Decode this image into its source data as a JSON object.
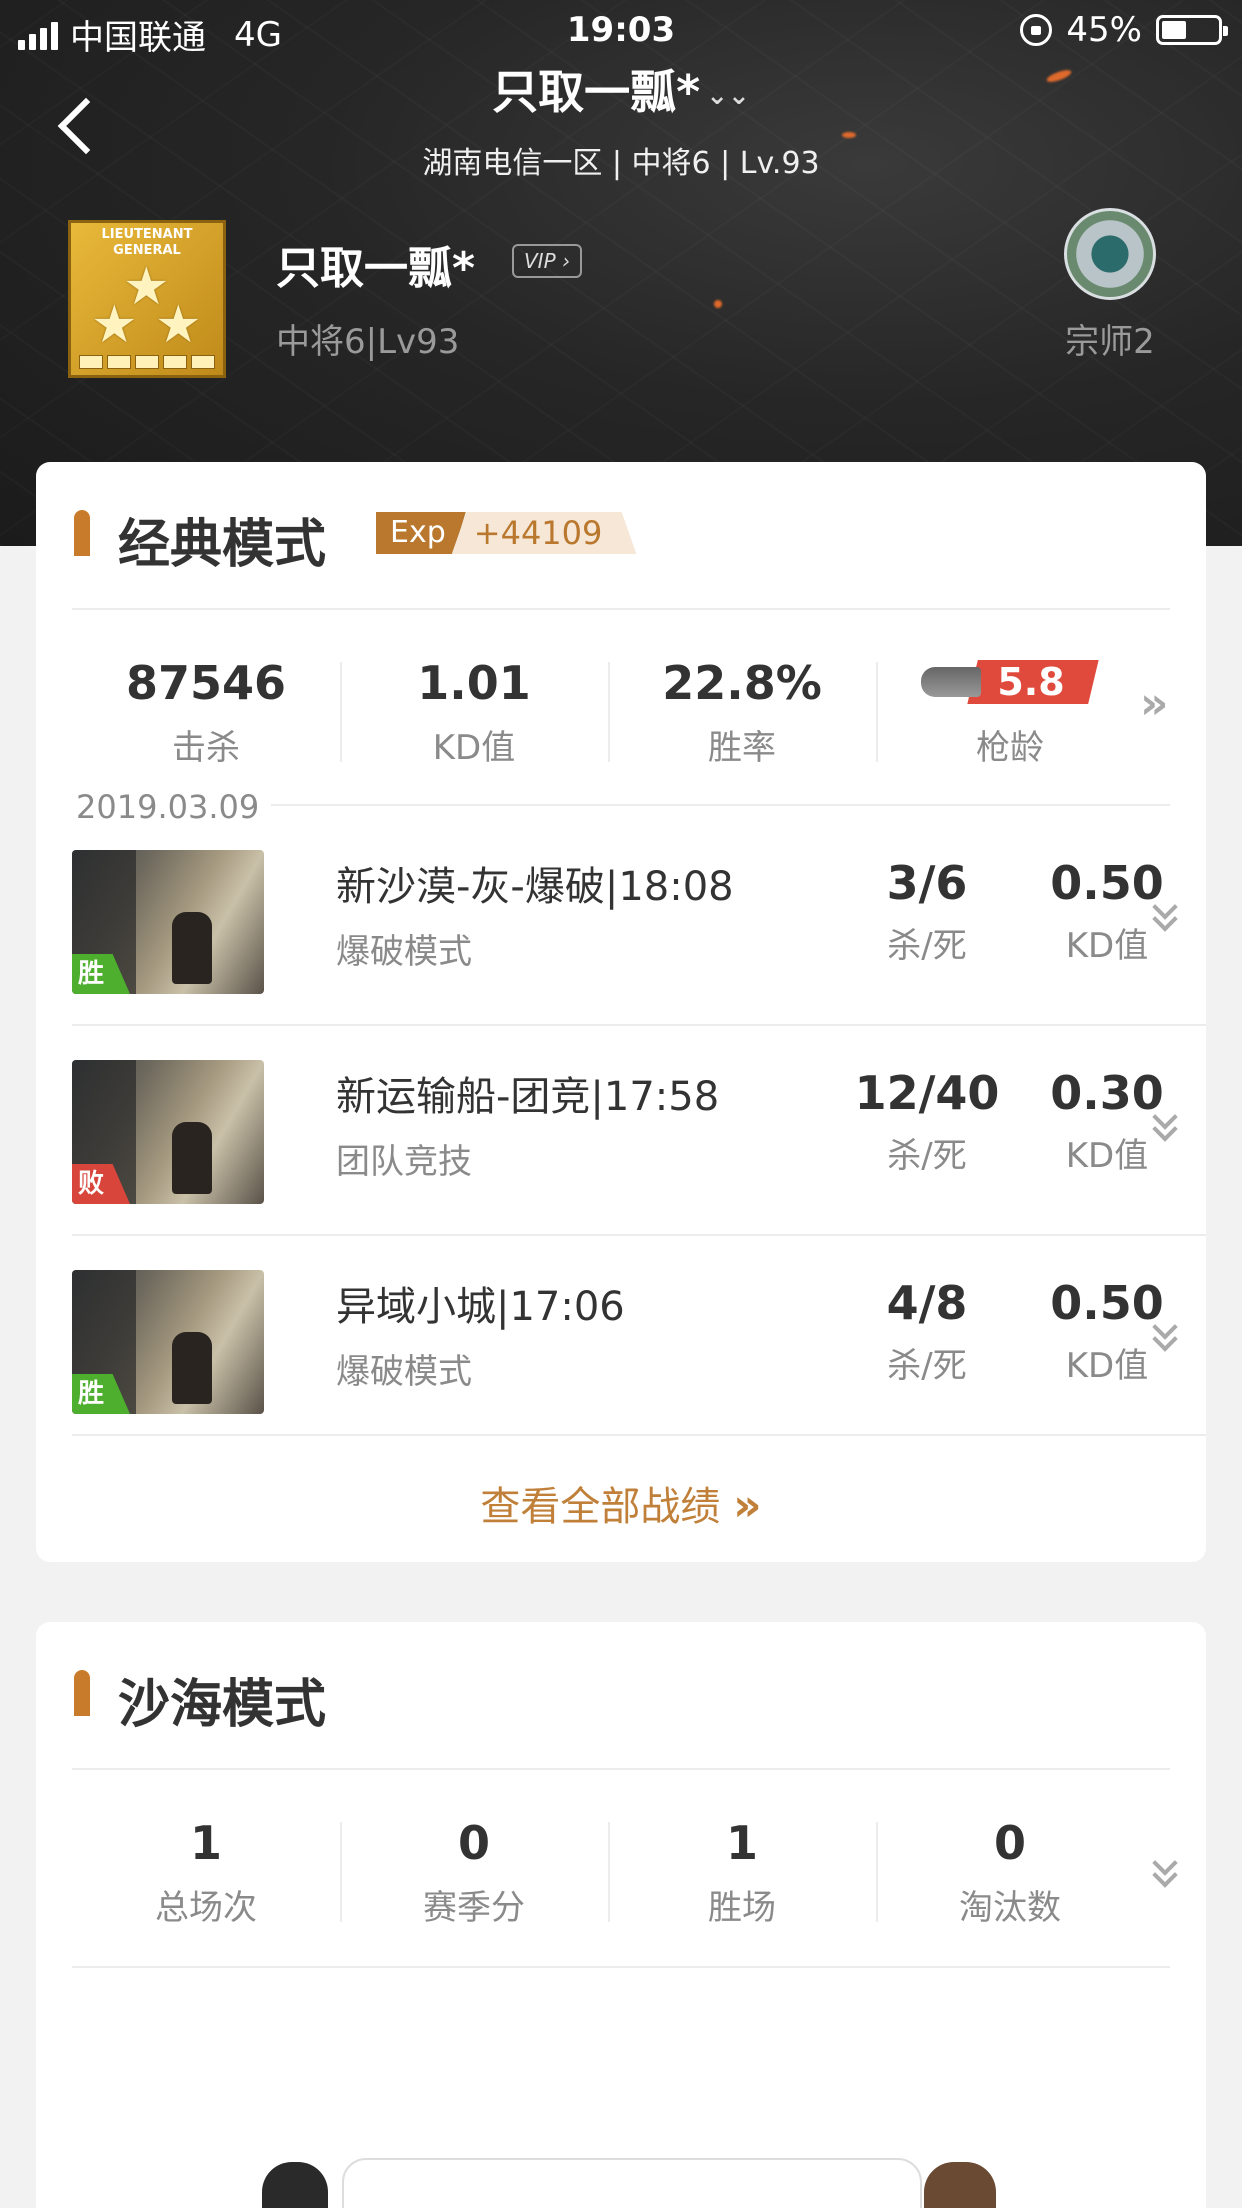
{
  "status_bar": {
    "carrier": "中国联通",
    "network": "4G",
    "time": "19:03",
    "battery": "45%",
    "battery_level": 0.45
  },
  "nav": {
    "title": "只取一瓢*",
    "subtitle": "湖南电信一区 | 中将6 | Lv.93"
  },
  "profile": {
    "badge_text": "LIEUTENANT GENERAL",
    "name": "只取一瓢*",
    "vip": "VIP",
    "level": "中将6|Lv93",
    "emblem_label": "宗师2"
  },
  "classic": {
    "title": "经典模式",
    "exp_label": "Exp",
    "exp_value": "+44109",
    "stats": [
      {
        "value": "87546",
        "label": "击杀"
      },
      {
        "value": "1.01",
        "label": "KD值"
      },
      {
        "value": "22.8%",
        "label": "胜率"
      },
      {
        "value": "5.8",
        "label": "枪龄"
      }
    ],
    "date": "2019.03.09",
    "matches": [
      {
        "title": "新沙漠-灰-爆破|18:08",
        "mode": "爆破模式",
        "result": "胜",
        "kd": "3/6",
        "kd_label": "杀/死",
        "ratio": "0.50",
        "ratio_label": "KD值"
      },
      {
        "title": "新运输船-团竞|17:58",
        "mode": "团队竞技",
        "result": "败",
        "kd": "12/40",
        "kd_label": "杀/死",
        "ratio": "0.30",
        "ratio_label": "KD值"
      },
      {
        "title": "异域小城|17:06",
        "mode": "爆破模式",
        "result": "胜",
        "kd": "4/8",
        "kd_label": "杀/死",
        "ratio": "0.50",
        "ratio_label": "KD值"
      }
    ],
    "view_all": "查看全部战绩",
    "view_all_arrow": "»"
  },
  "sand": {
    "title": "沙海模式",
    "stats": [
      {
        "value": "1",
        "label": "总场次"
      },
      {
        "value": "0",
        "label": "赛季分"
      },
      {
        "value": "1",
        "label": "胜场"
      },
      {
        "value": "0",
        "label": "淘汰数"
      }
    ]
  },
  "colors": {
    "accent": "#c97b2c",
    "win": "#4eae2e",
    "lose": "#d8453a",
    "gun_age": "#e04a3c"
  },
  "icons": [
    "back-arrow-icon",
    "chevron-down-icon",
    "signal-icon",
    "rotation-lock-icon",
    "battery-icon",
    "rank-badge-icon",
    "rank-emblem-icon",
    "bullet-icon",
    "gun-icon",
    "double-chevron-right-icon",
    "expand-chevron-icon"
  ]
}
